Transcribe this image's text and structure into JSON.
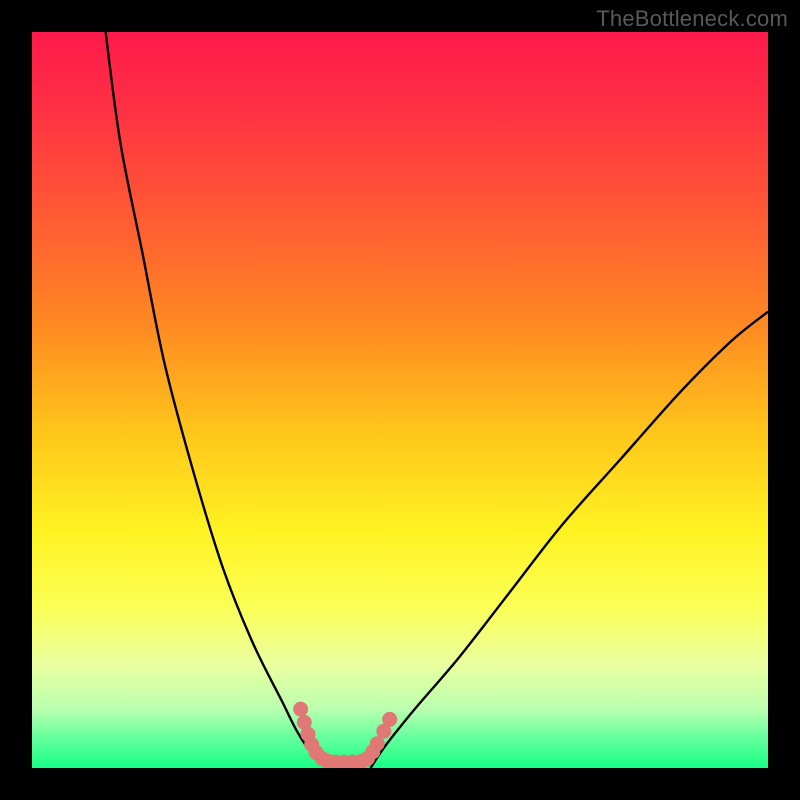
{
  "watermark": "TheBottleneck.com",
  "chart_data": {
    "type": "line",
    "title": "",
    "xlabel": "",
    "ylabel": "",
    "xlim": [
      0,
      100
    ],
    "ylim": [
      0,
      100
    ],
    "series": [
      {
        "name": "left-curve",
        "x": [
          10,
          12,
          15,
          18,
          22,
          26,
          30,
          34,
          36,
          38,
          40
        ],
        "y": [
          100,
          85,
          70,
          55,
          40,
          27,
          17,
          9,
          5,
          2,
          0
        ]
      },
      {
        "name": "right-curve",
        "x": [
          46,
          48,
          52,
          58,
          65,
          72,
          80,
          88,
          95,
          100
        ],
        "y": [
          0,
          3,
          8,
          15,
          24,
          33,
          42,
          51,
          58,
          62
        ]
      }
    ],
    "gradient_stops": [
      {
        "offset": 0.0,
        "color": "#ff1a4b"
      },
      {
        "offset": 0.1,
        "color": "#ff2f44"
      },
      {
        "offset": 0.25,
        "color": "#ff5a33"
      },
      {
        "offset": 0.4,
        "color": "#ff8a22"
      },
      {
        "offset": 0.55,
        "color": "#ffc81a"
      },
      {
        "offset": 0.68,
        "color": "#fff323"
      },
      {
        "offset": 0.78,
        "color": "#fbff55"
      },
      {
        "offset": 0.86,
        "color": "#eaffa0"
      },
      {
        "offset": 0.92,
        "color": "#baffb0"
      },
      {
        "offset": 0.96,
        "color": "#63ff9c"
      },
      {
        "offset": 1.0,
        "color": "#17ff85"
      }
    ],
    "dotted_segment": {
      "name": "bottom-dots",
      "color": "#e07876",
      "points": [
        {
          "x": 36.5,
          "y": 8.0
        },
        {
          "x": 37.0,
          "y": 6.2
        },
        {
          "x": 37.5,
          "y": 4.6
        },
        {
          "x": 38.0,
          "y": 3.2
        },
        {
          "x": 38.6,
          "y": 2.1
        },
        {
          "x": 39.4,
          "y": 1.3
        },
        {
          "x": 40.2,
          "y": 0.9
        },
        {
          "x": 41.2,
          "y": 0.8
        },
        {
          "x": 42.4,
          "y": 0.8
        },
        {
          "x": 43.6,
          "y": 0.8
        },
        {
          "x": 44.8,
          "y": 0.9
        },
        {
          "x": 45.6,
          "y": 1.3
        },
        {
          "x": 46.3,
          "y": 2.2
        },
        {
          "x": 46.9,
          "y": 3.3
        },
        {
          "x": 47.8,
          "y": 5.0
        },
        {
          "x": 48.6,
          "y": 6.6
        }
      ]
    }
  }
}
